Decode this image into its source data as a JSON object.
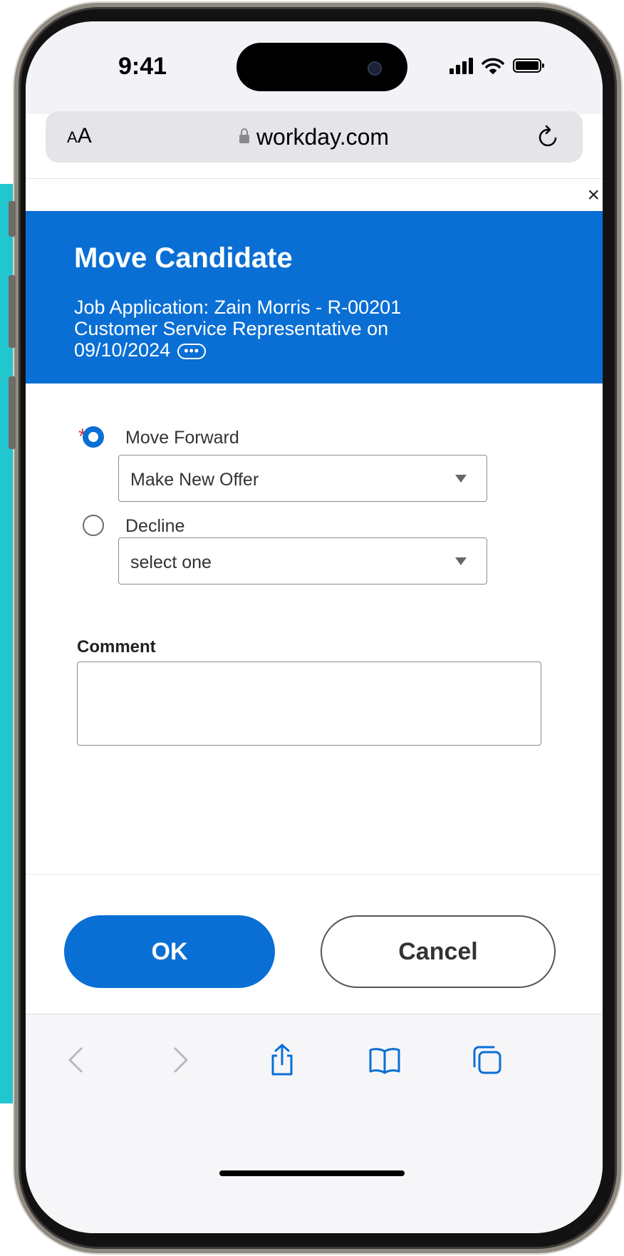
{
  "status_bar": {
    "time": "9:41"
  },
  "browser": {
    "text_size_small": "A",
    "text_size_large": "A",
    "url": "workday.com"
  },
  "dialog": {
    "close_glyph": "×",
    "title": "Move Candidate",
    "subtitle_line1": "Job Application: Zain Morris - R-00201",
    "subtitle_line2": "Customer Service Representative on",
    "subtitle_line3": "09/10/2024",
    "required_marker": "*",
    "options": [
      {
        "label": "Move Forward",
        "selected": true,
        "select_value": "Make New Offer"
      },
      {
        "label": "Decline",
        "selected": false,
        "select_value": "select one"
      }
    ],
    "comment_label": "Comment",
    "comment_value": "",
    "ok_label": "OK",
    "cancel_label": "Cancel"
  },
  "toolbar": {
    "items": [
      "back-icon",
      "forward-icon",
      "share-icon",
      "bookmarks-icon",
      "tabs-icon"
    ]
  },
  "colors": {
    "accent": "#0a6fd4",
    "required": "#d92b2b",
    "backdrop": "#22c6cf"
  }
}
